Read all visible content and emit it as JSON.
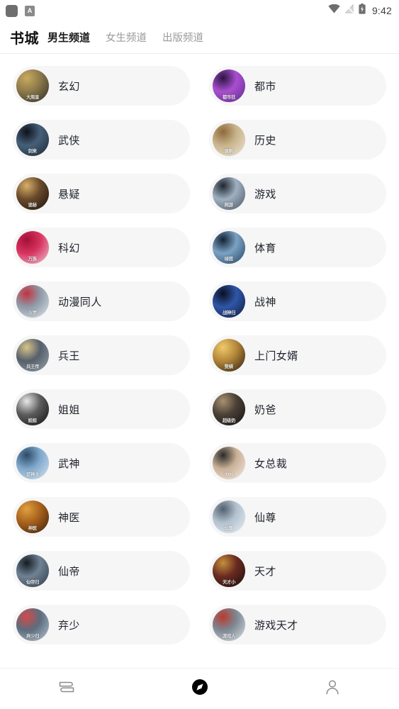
{
  "status_bar": {
    "left_icons": [
      {
        "name": "app-badge-square",
        "glyph": ""
      },
      {
        "name": "app-badge-letter",
        "glyph": "A"
      }
    ],
    "wifi_icon": "wifi-icon",
    "signal_icon": "signal-icon",
    "battery_icon": "battery-icon",
    "time": "9:42"
  },
  "header": {
    "brand": "书城",
    "tabs": [
      {
        "label": "男生频道",
        "active": true
      },
      {
        "label": "女生频道",
        "active": false
      },
      {
        "label": "出版频道",
        "active": false
      }
    ]
  },
  "categories": [
    {
      "label": "玄幻",
      "cover_text": "大周皇",
      "c1": "#2c2a24",
      "c2": "#8d7a4a",
      "c3": "#c9ab5f"
    },
    {
      "label": "都市",
      "cover_text": "都市狂",
      "c1": "#5e2a8c",
      "c2": "#a94fd0",
      "c3": "#2a1440"
    },
    {
      "label": "武侠",
      "cover_text": "剑来",
      "c1": "#1b2733",
      "c2": "#46607a",
      "c3": "#0d1219"
    },
    {
      "label": "历史",
      "cover_text": "唐朝",
      "c1": "#efe6d6",
      "c2": "#c8b48c",
      "c3": "#8e6a3a"
    },
    {
      "label": "悬疑",
      "cover_text": "诡秘",
      "c1": "#17120d",
      "c2": "#6a4a2a",
      "c3": "#d8b06a"
    },
    {
      "label": "游戏",
      "cover_text": "网游",
      "c1": "#4a5664",
      "c2": "#9fb0c0",
      "c3": "#1e262f"
    },
    {
      "label": "科幻",
      "cover_text": "万族",
      "c1": "#f0c6d8",
      "c2": "#d7325e",
      "c3": "#a31038"
    },
    {
      "label": "体育",
      "cover_text": "绿茵",
      "c1": "#23425f",
      "c2": "#7ba2c4",
      "c3": "#122233"
    },
    {
      "label": "动漫同人",
      "cover_text": "斗罗",
      "c1": "#dfe4ea",
      "c2": "#8e9aa8",
      "c3": "#c2333f"
    },
    {
      "label": "战神",
      "cover_text": "战神归",
      "c1": "#101a3a",
      "c2": "#2f56a8",
      "c3": "#0a0f22"
    },
    {
      "label": "兵王",
      "cover_text": "兵王传",
      "c1": "#9aa3ab",
      "c2": "#55606b",
      "c3": "#d8c48a"
    },
    {
      "label": "上门女婿",
      "cover_text": "赘婿",
      "c1": "#2a1c0c",
      "c2": "#b4873a",
      "c3": "#f0c96a"
    },
    {
      "label": "姐姐",
      "cover_text": "姐姐",
      "c1": "#0e0e0e",
      "c2": "#5c5c5c",
      "c3": "#e8e8e8"
    },
    {
      "label": "奶爸",
      "cover_text": "超级奶",
      "c1": "#12100e",
      "c2": "#4a4036",
      "c3": "#a89070"
    },
    {
      "label": "武神",
      "cover_text": "武神主",
      "c1": "#d8e6f2",
      "c2": "#7fa8cc",
      "c3": "#2c4a66"
    },
    {
      "label": "女总裁",
      "cover_text": "9999",
      "c1": "#f4ece2",
      "c2": "#c9b096",
      "c3": "#2a2a2a"
    },
    {
      "label": "神医",
      "cover_text": "神医",
      "c1": "#3a1d08",
      "c2": "#a8621c",
      "c3": "#e0a040"
    },
    {
      "label": "仙尊",
      "cover_text": "仙尊",
      "c1": "#e9eef3",
      "c2": "#b3c2cf",
      "c3": "#52606e"
    },
    {
      "label": "仙帝",
      "cover_text": "仙帝归",
      "c1": "#2e3a48",
      "c2": "#6f8294",
      "c3": "#141b22"
    },
    {
      "label": "天才",
      "cover_text": "天才小",
      "c1": "#140f0c",
      "c2": "#6a2a20",
      "c3": "#c4903c"
    },
    {
      "label": "弃少",
      "cover_text": "弃少归",
      "c1": "#b9c6d2",
      "c2": "#5b6d7e",
      "c3": "#d24a4a"
    },
    {
      "label": "游戏天才",
      "cover_text": "游戏人",
      "c1": "#dfe3e7",
      "c2": "#7c8894",
      "c3": "#b93a2e"
    }
  ],
  "bottom_nav": [
    {
      "name": "bookshelf",
      "icon": "books-icon",
      "active": false
    },
    {
      "name": "discover",
      "icon": "compass-icon",
      "active": true
    },
    {
      "name": "profile",
      "icon": "person-icon",
      "active": false
    }
  ],
  "colors": {
    "pill_bg": "#f6f6f7",
    "active_text": "#1a1a1a",
    "inactive_text": "#9a9a9a",
    "page_bg": "#ffffff"
  }
}
